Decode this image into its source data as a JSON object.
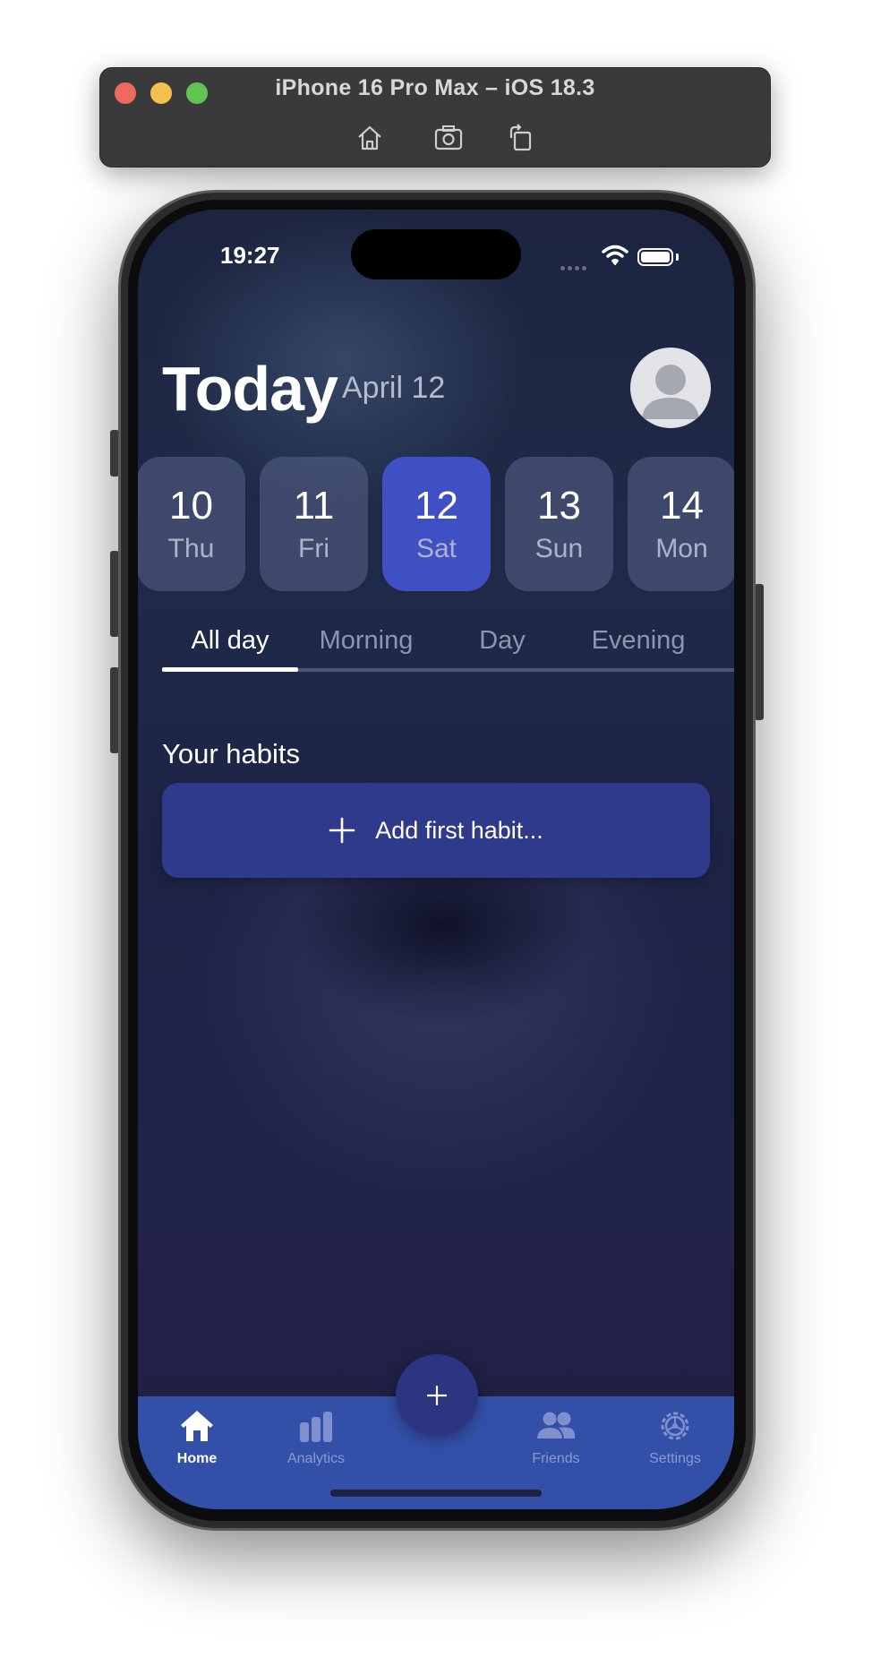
{
  "simulator": {
    "title": "iPhone 16 Pro Max – iOS 18.3",
    "tools": [
      "home-icon",
      "screenshot-icon",
      "rotate-icon"
    ]
  },
  "status_bar": {
    "time": "19:27",
    "icons": [
      "cellular-icon",
      "wifi-icon",
      "battery-icon"
    ]
  },
  "header": {
    "title": "Today",
    "date": "April 12"
  },
  "days": [
    {
      "number": "10",
      "name": "Thu",
      "selected": false
    },
    {
      "number": "11",
      "name": "Fri",
      "selected": false
    },
    {
      "number": "12",
      "name": "Sat",
      "selected": true
    },
    {
      "number": "13",
      "name": "Sun",
      "selected": false
    },
    {
      "number": "14",
      "name": "Mon",
      "selected": false
    }
  ],
  "time_tabs": [
    {
      "label": "All day",
      "active": true
    },
    {
      "label": "Morning",
      "active": false
    },
    {
      "label": "Day",
      "active": false
    },
    {
      "label": "Evening",
      "active": false
    }
  ],
  "habits": {
    "section_title": "Your habits",
    "add_label": "Add first habit..."
  },
  "tab_bar": {
    "items": [
      {
        "label": "Home",
        "icon": "home-icon",
        "active": true
      },
      {
        "label": "Analytics",
        "icon": "bar-chart-icon",
        "active": false
      },
      {
        "label": "Friends",
        "icon": "people-icon",
        "active": false
      },
      {
        "label": "Settings",
        "icon": "gear-icon",
        "active": false
      }
    ],
    "center_button_icon": "plus-icon"
  },
  "colors": {
    "accent": "#3e50c4",
    "tab_bar": "#3350a8",
    "add_habit_button": "#2f3a8a"
  }
}
